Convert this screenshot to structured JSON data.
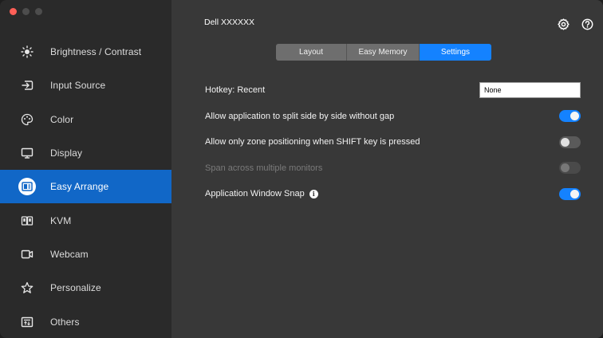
{
  "window": {
    "title": "Dell XXXXXX"
  },
  "sidebar": {
    "items": [
      {
        "label": "Brightness / Contrast",
        "icon": "sun-icon"
      },
      {
        "label": "Input Source",
        "icon": "input-source-icon"
      },
      {
        "label": "Color",
        "icon": "palette-icon"
      },
      {
        "label": "Display",
        "icon": "monitor-icon"
      },
      {
        "label": "Easy Arrange",
        "icon": "easy-arrange-icon",
        "active": true
      },
      {
        "label": "KVM",
        "icon": "kvm-icon"
      },
      {
        "label": "Webcam",
        "icon": "webcam-icon"
      },
      {
        "label": "Personalize",
        "icon": "star-icon"
      },
      {
        "label": "Others",
        "icon": "others-icon"
      }
    ]
  },
  "tabs": [
    {
      "label": "Layout"
    },
    {
      "label": "Easy Memory"
    },
    {
      "label": "Settings",
      "active": true
    }
  ],
  "settings": {
    "hotkey": {
      "label": "Hotkey: Recent",
      "value": "None"
    },
    "split_gap": {
      "label": "Allow application to split side by side without gap",
      "state": "on"
    },
    "shift_zone": {
      "label": "Allow only zone positioning when SHIFT key is pressed",
      "state": "off"
    },
    "span_monitors": {
      "label": "Span across multiple monitors",
      "state": "disabled"
    },
    "window_snap": {
      "label": "Application Window Snap",
      "info_glyph": "i",
      "state": "on"
    }
  },
  "colors": {
    "accent": "#1482ff",
    "active_nav": "#1167c7",
    "sidebar_bg": "#2a2a2a",
    "main_bg": "#383838"
  }
}
